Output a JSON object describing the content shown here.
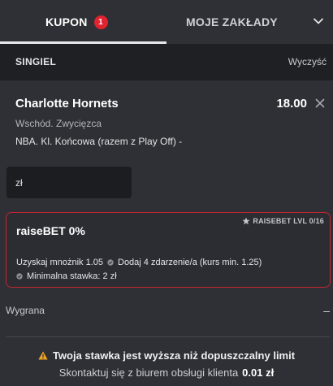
{
  "tabs": {
    "kupon": {
      "label": "KUPON",
      "badge": "1"
    },
    "moje": {
      "label": "MOJE ZAKŁADY"
    }
  },
  "subbar": {
    "title": "SINGIEL",
    "clear_label": "Wyczyść"
  },
  "bet": {
    "team": "Charlotte Hornets",
    "odds": "18.00",
    "market": "Wschód. Zwycięzca",
    "event": "NBA. Kl. Końcowa (razem z Play Off) -"
  },
  "stake": {
    "currency": "zł"
  },
  "raise": {
    "title": "raiseBET 0%",
    "level": "RAISEBET LVL 0/16",
    "multiplier": "Uzyskaj mnożnik 1.05",
    "add_events": "Dodaj 4 zdarzenie/a (kurs min. 1.25)",
    "min_stake": "Minimalna stawka: 2 zł"
  },
  "winnings": {
    "label": "Wygrana",
    "value": "–"
  },
  "warning": {
    "title": "Twoja stawka jest wyższa niż dopuszczalny limit",
    "contact_text": "Skontaktuj się z biurem obsługi klienta",
    "contact_amount": "0.01 zł"
  },
  "icons": {
    "tab_toggle": "chevron-down-icon",
    "remove": "close-icon",
    "level": "star-icon",
    "bullet": "check-circle-icon",
    "warning": "warning-icon"
  },
  "colors": {
    "accent": "#e0232e",
    "raise_border": "#c0262f",
    "warning": "#f2a623",
    "background": "#2f3035",
    "subbar": "#1f2024"
  }
}
